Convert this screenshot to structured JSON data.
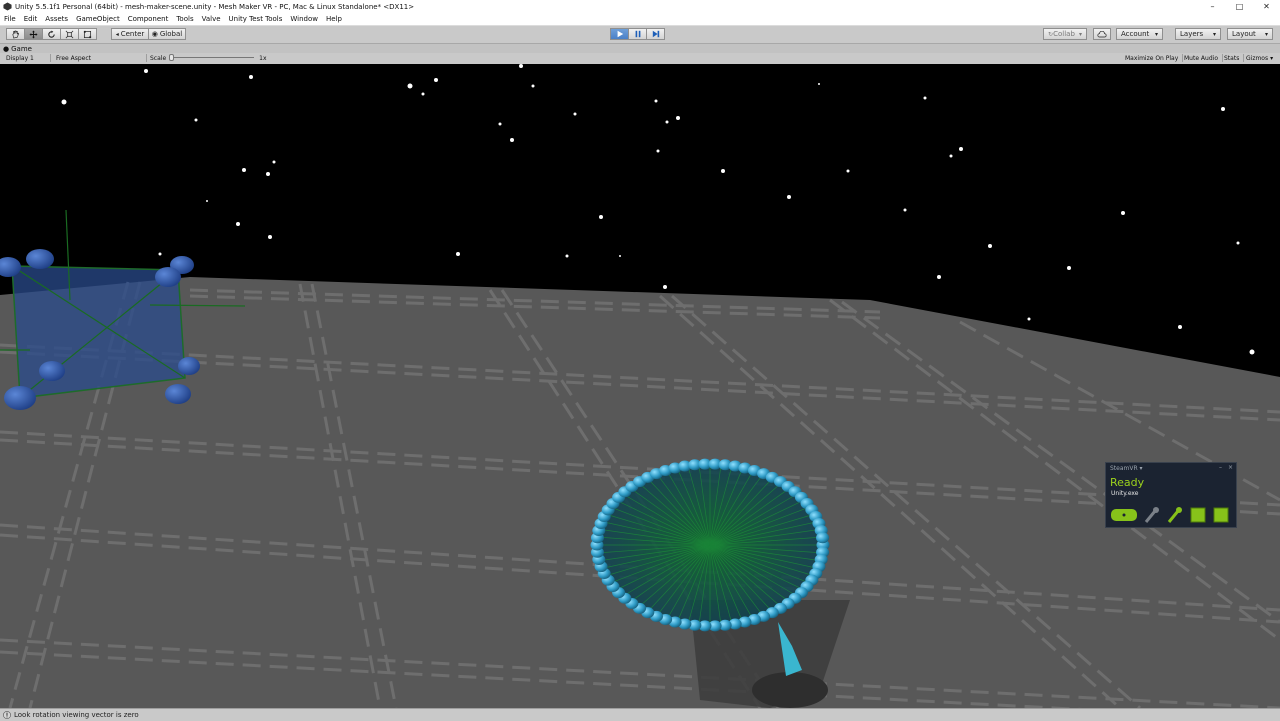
{
  "window": {
    "title": "Unity 5.5.1f1 Personal (64bit) - mesh-maker-scene.unity - Mesh Maker VR - PC, Mac & Linux Standalone* <DX11>",
    "buttons": {
      "minimize": "–",
      "maximize": "□",
      "close": "✕"
    }
  },
  "menu": [
    "File",
    "Edit",
    "Assets",
    "GameObject",
    "Component",
    "Tools",
    "Valve",
    "Unity Test Tools",
    "Window",
    "Help"
  ],
  "toolbar": {
    "pivot_label": "Center",
    "space_label": "Global",
    "collab_label": "Collab",
    "account_label": "Account",
    "layers_label": "Layers",
    "layout_label": "Layout",
    "play_active": true
  },
  "game": {
    "tab_label": "Game",
    "display": "Display 1",
    "aspect": "Free Aspect",
    "scale_label": "Scale",
    "scale_value": "1x",
    "toggles": [
      "Maximize On Play",
      "Mute Audio",
      "Stats",
      "Gizmos"
    ]
  },
  "steamvr": {
    "header": "SteamVR ▾",
    "status": "Ready",
    "app": "Unity.exe"
  },
  "status_bar": {
    "message": "Look rotation viewing vector is zero"
  },
  "colors": {
    "accent_blue": "#4a80c8",
    "ready_green": "#9bd11d",
    "floor": "#555555",
    "sphere_blue": "#3a9ac0"
  }
}
